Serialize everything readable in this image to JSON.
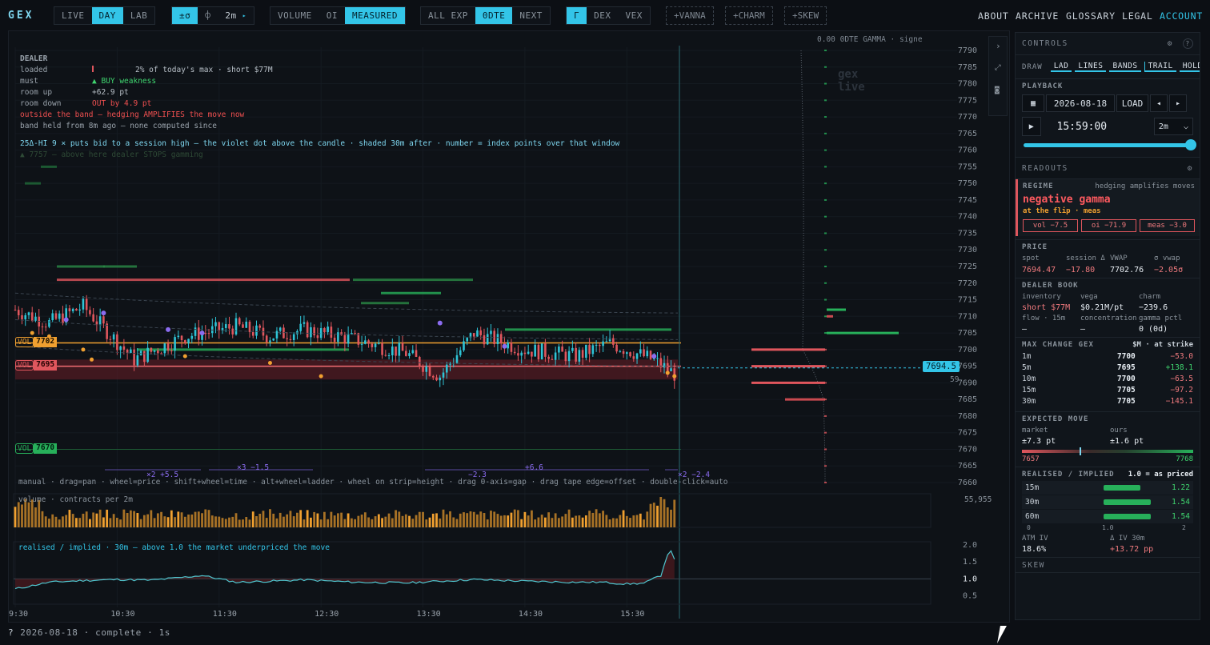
{
  "app": {
    "logo": "GEX"
  },
  "toolbar": {
    "mode": [
      "LIVE",
      "DAY",
      "LAB"
    ],
    "mode_active": 1,
    "sigma": "±σ",
    "phi": "⌽",
    "interval": "2m",
    "interval_arrow": "▸",
    "flow": [
      "VOLUME",
      "OI",
      "MEASURED"
    ],
    "flow_active": 2,
    "expiry": [
      "ALL EXP",
      "0DTE",
      "NEXT"
    ],
    "expiry_active": 1,
    "greek": [
      "Γ",
      "DEX",
      "VEX"
    ],
    "greek_active": 0,
    "extras": [
      "+VANNA",
      "+CHARM",
      "+SKEW"
    ]
  },
  "nav": [
    "ABOUT",
    "ARCHIVE",
    "GLOSSARY",
    "LEGAL",
    "ACCOUNT"
  ],
  "hud": {
    "title": "DEALER",
    "loaded_k": "loaded",
    "loaded_v": "2% of today's max · short $77M",
    "must_k": "must",
    "must_v": "▲ BUY weakness",
    "up_k": "room up",
    "up_v": "+62.9 pt",
    "down_k": "room down",
    "down_v": "OUT by 4.9 pt",
    "outside": "outside the band — hedging AMPLIFIES the move now",
    "held": "band held from 8m ago — none computed since",
    "hint": "25Δ-HI 9 × puts bid to a session high — the violet dot above the candle · shaded 30m after · number = index points over that window",
    "ghost": "▲ 7757 — above here dealer STOPS gamming"
  },
  "profile_header": "0.00   0DTE GAMMA · signe",
  "watermark": [
    "gex",
    "live"
  ],
  "levels": [
    {
      "tag": "VOL",
      "price": "7702"
    },
    {
      "tag": "VOL",
      "price": "7695"
    },
    {
      "tag": "VOL",
      "price": "7670"
    }
  ],
  "spot_tag": "7694.5",
  "spot_sub": "59",
  "y_ticks": [
    "7790",
    "7785",
    "7780",
    "7775",
    "7770",
    "7765",
    "7760",
    "7755",
    "7750",
    "7745",
    "7740",
    "7735",
    "7730",
    "7725",
    "7720",
    "7715",
    "7710",
    "7705",
    "7700",
    "7695",
    "7690",
    "7685",
    "7680",
    "7675",
    "7670",
    "7665",
    "7660"
  ],
  "x_ticks": [
    "9:30",
    "10:30",
    "11:30",
    "12:30",
    "13:30",
    "14:30",
    "15:30"
  ],
  "moves": [
    "×2 +5.5",
    "×3 −1.5",
    "−2.3",
    "+6.6",
    "×2 −2.4"
  ],
  "help": "manual · drag=pan · wheel=price · shift+wheel=time · alt+wheel=ladder · wheel on strip=height · drag 0-axis=gap · drag tape edge=offset · double-click=auto",
  "volume": {
    "label": "volume · contracts per 2m",
    "max": "55,955"
  },
  "realised": {
    "label": "realised / implied · 30m  –  above 1.0 the market underpriced the move",
    "ticks": [
      "2.0",
      "1.5",
      "1.0",
      "0.5"
    ]
  },
  "status": {
    "help": "?",
    "text": "2026-08-18 · complete · 1s"
  },
  "panel": {
    "controls": "CONTROLS",
    "gear": "⚙",
    "q": "?",
    "draw_label": "DRAW",
    "draw": [
      "LAD",
      "LINES",
      "BANDS",
      "TRAIL",
      "HOLD"
    ],
    "playback": "PLAYBACK",
    "date": "2026-08-18",
    "load": "LOAD",
    "prev": "◂",
    "next": "▸",
    "play": "▶",
    "time": "15:59:00",
    "speed": "2m",
    "speed_caret": "⌵",
    "progress": 1.0,
    "readouts": "READOUTS",
    "regime_label": "REGIME",
    "regime_note": "hedging amplifies moves",
    "regime": "negative gamma",
    "regime_sub": "at the flip · meas",
    "chips": [
      "vol −7.5",
      "oi −71.9",
      "meas −3.0"
    ],
    "price_label": "PRICE",
    "price_heads": [
      "spot",
      "session Δ",
      "VWAP",
      "σ vwap"
    ],
    "price_vals": [
      "7694.47",
      "−17.80",
      "7702.76",
      "−2.05σ"
    ],
    "book_label": "DEALER BOOK",
    "book_heads": [
      "inventory",
      "vega",
      "charm"
    ],
    "book_vals": [
      "short $77M",
      "$0.21M/pt",
      "−239.6"
    ],
    "book_heads2": [
      "flow · 15m",
      "concentration",
      "gamma pctl"
    ],
    "book_vals2": [
      "–",
      "–",
      "0 (0d)"
    ],
    "mcg_label": "MAX CHANGE GEX",
    "mcg_note": "$M · at strike",
    "mcg": [
      {
        "w": "1m",
        "k": "7700",
        "v": "−53.0"
      },
      {
        "w": "5m",
        "k": "7695",
        "v": "+138.1"
      },
      {
        "w": "10m",
        "k": "7700",
        "v": "−63.5"
      },
      {
        "w": "15m",
        "k": "7705",
        "v": "−97.2"
      },
      {
        "w": "30m",
        "k": "7705",
        "v": "−145.1"
      }
    ],
    "em_label": "EXPECTED MOVE",
    "em_heads": [
      "market",
      "ours"
    ],
    "em_vals": [
      "±7.3 pt",
      "±1.6 pt"
    ],
    "em_lo": "7657",
    "em_hi": "7768",
    "ri_label": "REALISED / IMPLIED",
    "ri_note": "1.0 = as priced",
    "ri": [
      {
        "w": "15m",
        "v": "1.22",
        "f": 0.61
      },
      {
        "w": "30m",
        "v": "1.54",
        "f": 0.77
      },
      {
        "w": "60m",
        "v": "1.54",
        "f": 0.77
      }
    ],
    "ri_axis": [
      "0",
      "1.0",
      "2"
    ],
    "atm_label": "ATM IV",
    "atm": "18.6%",
    "div_label": "Δ IV 30m",
    "div": "+13.72 pp",
    "skew": "SKEW"
  },
  "colors": {
    "accent": "#33c5e8",
    "down": "#e0565d",
    "up": "#27b05a",
    "warn": "#f0a030",
    "violet": "#8b6cf0"
  }
}
